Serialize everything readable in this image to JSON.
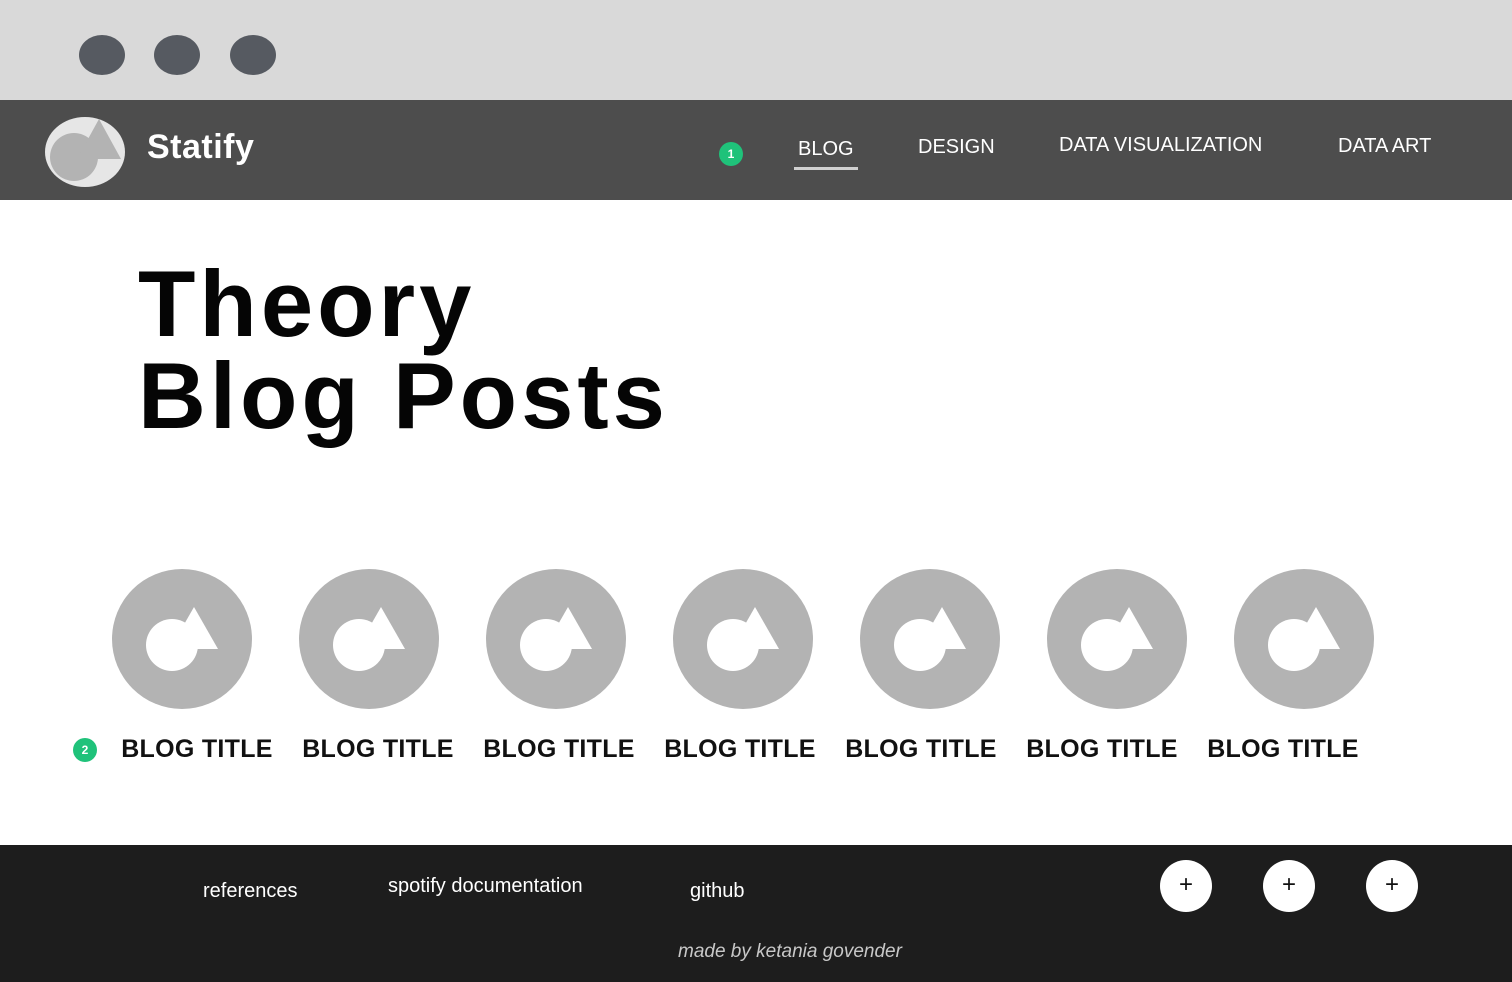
{
  "colors": {
    "chrome": "#d9d9d9",
    "window_dot": "#565a61",
    "header_bg": "#4d4d4d",
    "badge": "#1fc27a",
    "post_icon_bg": "#b3b3b3",
    "footer_bg": "#1d1d1d"
  },
  "header": {
    "brand": "Statify",
    "logo_icon": "statify-logo-icon",
    "nav_badge": "1",
    "nav": [
      {
        "label": "BLOG",
        "active": true
      },
      {
        "label": "DESIGN",
        "active": false
      },
      {
        "label": "DATA VISUALIZATION",
        "active": false
      },
      {
        "label": "DATA ART",
        "active": false
      }
    ]
  },
  "hero": {
    "line1": "Theory",
    "line2": "Blog Posts"
  },
  "posts": {
    "badge": "2",
    "icon": "statify-logo-icon",
    "items": [
      {
        "title": "BLOG TITLE"
      },
      {
        "title": "BLOG TITLE"
      },
      {
        "title": "BLOG TITLE"
      },
      {
        "title": "BLOG TITLE"
      },
      {
        "title": "BLOG TITLE"
      },
      {
        "title": "BLOG TITLE"
      },
      {
        "title": "BLOG TITLE"
      }
    ]
  },
  "footer": {
    "links": [
      {
        "label": "references"
      },
      {
        "label": "spotify documentation"
      },
      {
        "label": "github"
      }
    ],
    "buttons": [
      {
        "icon": "plus-icon",
        "label": "+"
      },
      {
        "icon": "plus-icon",
        "label": "+"
      },
      {
        "icon": "plus-icon",
        "label": "+"
      }
    ],
    "credit": "made by ketania govender"
  }
}
